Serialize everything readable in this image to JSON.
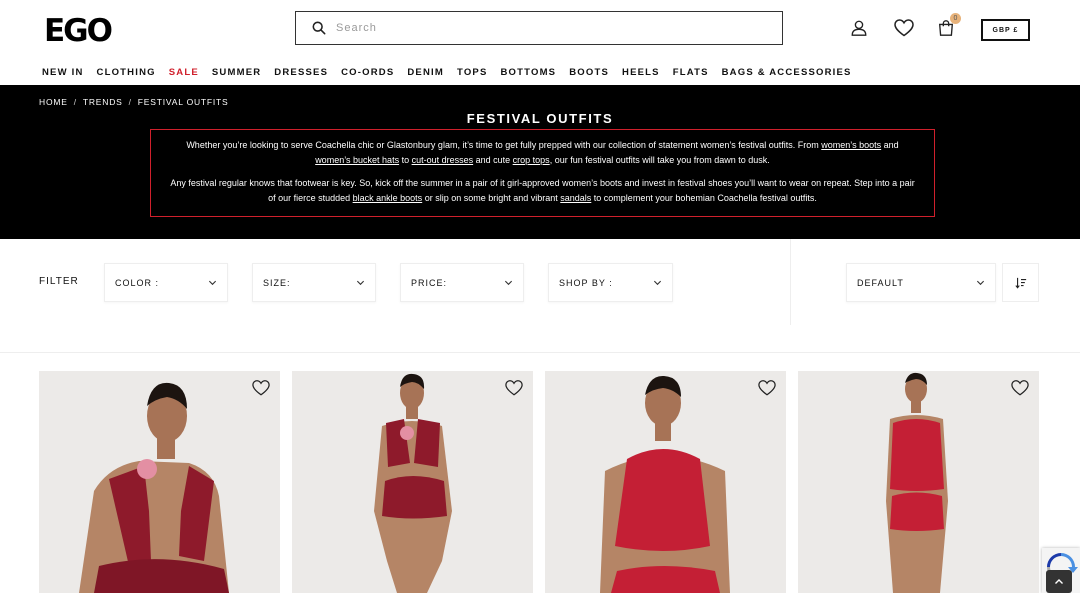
{
  "header": {
    "logo": "EGO",
    "search_placeholder": "Search",
    "cart_count": "0",
    "currency": "GBP £"
  },
  "nav": {
    "items": [
      {
        "label": "NEW IN"
      },
      {
        "label": "CLOTHING"
      },
      {
        "label": "SALE"
      },
      {
        "label": "SUMMER"
      },
      {
        "label": "DRESSES"
      },
      {
        "label": "CO-ORDS"
      },
      {
        "label": "DENIM"
      },
      {
        "label": "TOPS"
      },
      {
        "label": "BOTTOMS"
      },
      {
        "label": "BOOTS"
      },
      {
        "label": "HEELS"
      },
      {
        "label": "FLATS"
      },
      {
        "label": "BAGS & ACCESSORIES"
      }
    ]
  },
  "breadcrumb": {
    "items": [
      "HOME",
      "TRENDS",
      "FESTIVAL OUTFITS"
    ],
    "separator": "/"
  },
  "hero": {
    "title": "FESTIVAL OUTFITS",
    "p1": {
      "t1": "Whether you’re looking to serve Coachella chic or Glastonbury glam, it’s time to get fully prepped with our collection of statement women’s festival outfits. From ",
      "l1": "women’s boots",
      "t2": " and ",
      "l2": "women’s bucket hats",
      "t3": " to ",
      "l3": "cut-out dresses",
      "t4": " and cute ",
      "l4": "crop tops",
      "t5": ", our fun festival outfits will take you from dawn to dusk."
    },
    "p2": {
      "t1": "Any festival regular knows that footwear is key. So, kick off the summer in a pair of it girl-approved women’s boots and invest in festival shoes you’ll want to wear on repeat. Step into a pair of our fierce studded ",
      "l1": "black ankle boots",
      "t2": " or slip on some bright and vibrant ",
      "l2": "sandals",
      "t3": " to complement your bohemian Coachella festival outfits."
    },
    "accent_color": "#d0202c"
  },
  "filters": {
    "label": "FILTER",
    "color": "COLOR :",
    "size": "SIZE:",
    "price": "PRICE:",
    "shop_by": "SHOP BY :",
    "sort": "DEFAULT"
  },
  "products": [
    {
      "icon": "wishlist-heart-icon"
    },
    {
      "icon": "wishlist-heart-icon"
    },
    {
      "icon": "wishlist-heart-icon"
    },
    {
      "icon": "wishlist-heart-icon"
    }
  ],
  "colors": {
    "sale": "#d0202c",
    "garment": "#8e1a2b",
    "garment_bright": "#c41f35"
  }
}
